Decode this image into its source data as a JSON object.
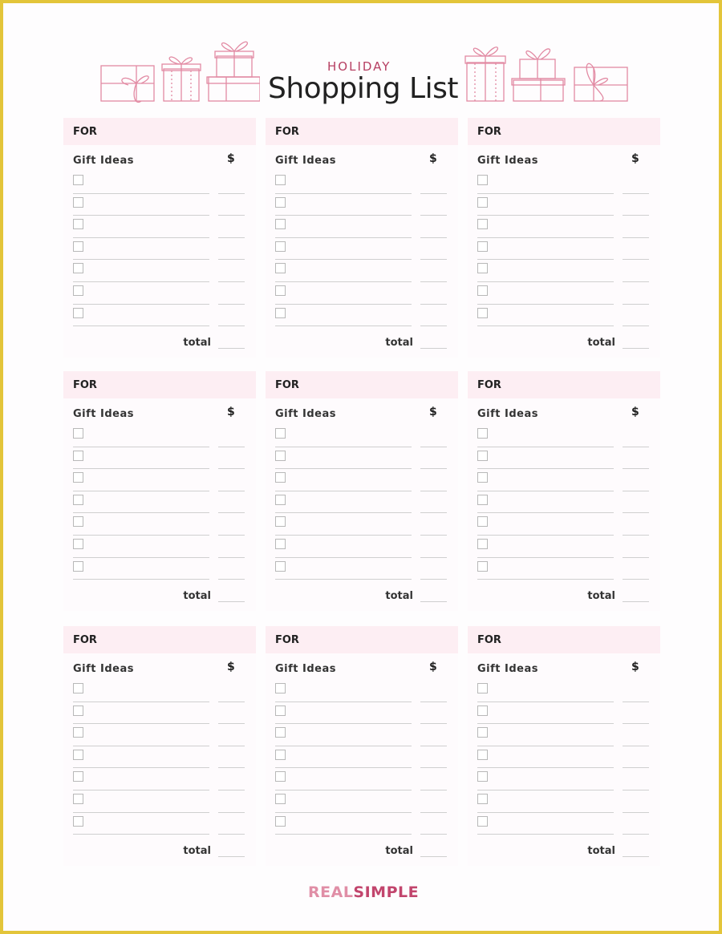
{
  "header": {
    "subtitle": "HOLIDAY",
    "title": "Shopping List",
    "illustration_color": "#e28aa3"
  },
  "cards": [
    {
      "for_label": "FOR",
      "gift_ideas_label": "Gift Ideas",
      "price_label": "$",
      "rows": 7,
      "total_label": "total"
    },
    {
      "for_label": "FOR",
      "gift_ideas_label": "Gift Ideas",
      "price_label": "$",
      "rows": 7,
      "total_label": "total"
    },
    {
      "for_label": "FOR",
      "gift_ideas_label": "Gift Ideas",
      "price_label": "$",
      "rows": 7,
      "total_label": "total"
    },
    {
      "for_label": "FOR",
      "gift_ideas_label": "Gift Ideas",
      "price_label": "$",
      "rows": 7,
      "total_label": "total"
    },
    {
      "for_label": "FOR",
      "gift_ideas_label": "Gift Ideas",
      "price_label": "$",
      "rows": 7,
      "total_label": "total"
    },
    {
      "for_label": "FOR",
      "gift_ideas_label": "Gift Ideas",
      "price_label": "$",
      "rows": 7,
      "total_label": "total"
    },
    {
      "for_label": "FOR",
      "gift_ideas_label": "Gift Ideas",
      "price_label": "$",
      "rows": 7,
      "total_label": "total"
    },
    {
      "for_label": "FOR",
      "gift_ideas_label": "Gift Ideas",
      "price_label": "$",
      "rows": 7,
      "total_label": "total"
    },
    {
      "for_label": "FOR",
      "gift_ideas_label": "Gift Ideas",
      "price_label": "$",
      "rows": 7,
      "total_label": "total"
    }
  ],
  "footer": {
    "brand_part1": "REAL",
    "brand_part2": "SIMPLE"
  },
  "colors": {
    "frame": "#e3c53a",
    "header_band": "#fdeef3",
    "accent": "#b63f62"
  }
}
